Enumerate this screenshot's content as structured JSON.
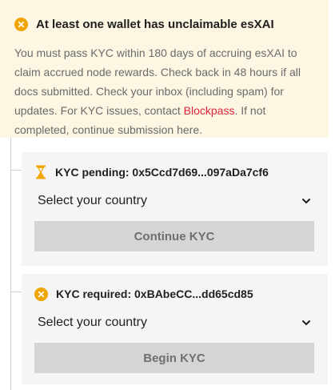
{
  "warning": {
    "icon": "x-circle-icon",
    "title": "At least one wallet has unclaimable esXAI",
    "body_text": "You must pass KYC within 180 days of accruing esXAI to claim accrued node rewards. Check back in 48 hours if all docs submitted. Check your inbox (including spam) for updates. For KYC issues, contact ",
    "link_text": "Blockpass",
    "body_tail": ". If not completed, continue submission here."
  },
  "wallets": [
    {
      "status_icon": "hourglass-icon",
      "title": "KYC pending: 0x5Ccd7d69...097aDa7cf6",
      "select_value": "Select your country",
      "button_label": "Continue KYC"
    },
    {
      "status_icon": "x-circle-icon",
      "title": "KYC required: 0xBAbeCC...dd65cd85",
      "select_value": "Select your country",
      "button_label": "Begin KYC"
    }
  ],
  "colors": {
    "warning_bg": "#fdf6e3",
    "accent_orange": "#f0a500",
    "link_red": "#e0243b",
    "card_bg": "#f5f5f5",
    "button_disabled_bg": "#d5d5d5"
  }
}
